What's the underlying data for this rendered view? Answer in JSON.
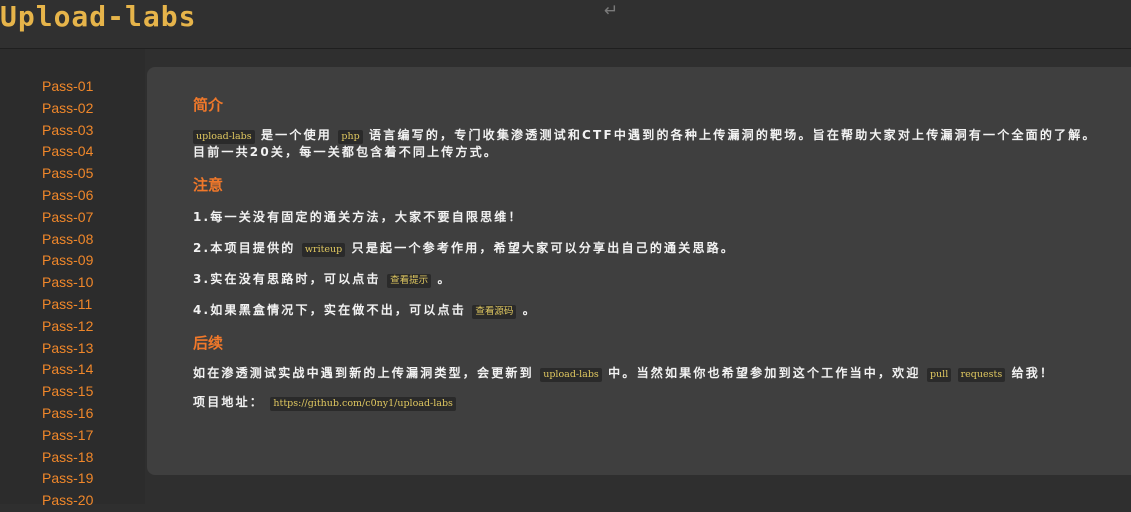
{
  "header": {
    "logo": "Upload-labs",
    "return_glyph": "↵"
  },
  "sidebar": {
    "items": [
      {
        "label": "Pass-01"
      },
      {
        "label": "Pass-02"
      },
      {
        "label": "Pass-03"
      },
      {
        "label": "Pass-04"
      },
      {
        "label": "Pass-05"
      },
      {
        "label": "Pass-06"
      },
      {
        "label": "Pass-07"
      },
      {
        "label": "Pass-08"
      },
      {
        "label": "Pass-09"
      },
      {
        "label": "Pass-10"
      },
      {
        "label": "Pass-11"
      },
      {
        "label": "Pass-12"
      },
      {
        "label": "Pass-13"
      },
      {
        "label": "Pass-14"
      },
      {
        "label": "Pass-15"
      },
      {
        "label": "Pass-16"
      },
      {
        "label": "Pass-17"
      },
      {
        "label": "Pass-18"
      },
      {
        "label": "Pass-19"
      },
      {
        "label": "Pass-20"
      }
    ]
  },
  "main": {
    "intro": {
      "heading": "简介",
      "code1": "upload-labs",
      "text1": "是一个使用",
      "code2": "php",
      "text2": "语言编写的，专门收集渗透测试和CTF中遇到的各种上传漏洞的靶场。旨在帮助大家对上传漏洞有一个全面的了解。目前一共20关，每一关都包含着不同上传方式。"
    },
    "notes": {
      "heading": "注意",
      "item1": "1.每一关没有固定的通关方法，大家不要自限思维！",
      "item2_pre": "2.本项目提供的",
      "item2_code": "writeup",
      "item2_post": "只是起一个参考作用，希望大家可以分享出自己的通关思路。",
      "item3_pre": "3.实在没有思路时，可以点击",
      "item3_code": "查看提示",
      "item3_post": "。",
      "item4_pre": "4.如果黑盒情况下，实在做不出，可以点击",
      "item4_code": "查看源码",
      "item4_post": "。"
    },
    "followup": {
      "heading": "后续",
      "text_pre": "如在渗透测试实战中遇到新的上传漏洞类型，会更新到",
      "code1": "upload-labs",
      "text_mid": "中。当然如果你也希望参加到这个工作当中，欢迎",
      "code2a": "pull",
      "code2b": "requests",
      "text_post": "给我！",
      "address_label": "项目地址：",
      "address_url": "https://github.com/c0ny1/upload-labs"
    }
  }
}
